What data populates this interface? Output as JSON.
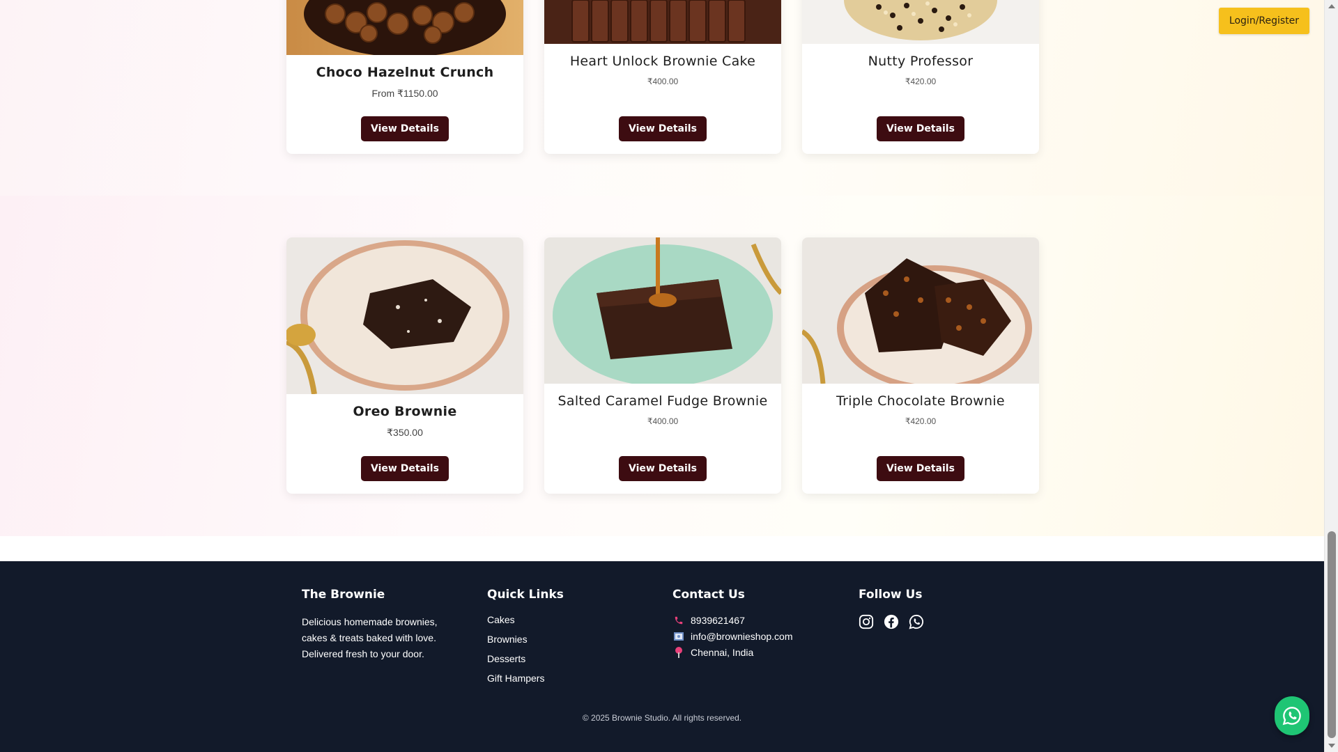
{
  "header": {
    "login_label": "Login/Register"
  },
  "products_top": [
    {
      "name": "Choco Hazelnut Crunch",
      "price": "From ₹1150.00",
      "button": "View Details"
    },
    {
      "name": "Heart Unlock Brownie Cake",
      "price": "₹400.00",
      "button": "View Details"
    },
    {
      "name": "Nutty Professor",
      "price": "₹420.00",
      "button": "View Details"
    }
  ],
  "products_bottom": [
    {
      "name": "Oreo Brownie",
      "price": "₹350.00",
      "button": "View Details"
    },
    {
      "name": "Salted Caramel Fudge Brownie",
      "price": "₹400.00",
      "button": "View Details"
    },
    {
      "name": "Triple Chocolate Brownie",
      "price": "₹420.00",
      "button": "View Details"
    }
  ],
  "footer": {
    "brand": {
      "title": "The Brownie",
      "description": "Delicious homemade brownies, cakes & treats baked with love. Delivered fresh to your door."
    },
    "quick_links": {
      "title": "Quick Links",
      "items": [
        "Cakes",
        "Brownies",
        "Desserts",
        "Gift Hampers"
      ]
    },
    "contact": {
      "title": "Contact Us",
      "phone": "8939621467",
      "email": "info@brownieshop.com",
      "location": "Chennai, India"
    },
    "follow": {
      "title": "Follow Us",
      "icons": [
        "instagram-icon",
        "facebook-icon",
        "whatsapp-icon"
      ]
    },
    "copyright": "© 2025 Brownie Studio. All rights reserved."
  },
  "colors": {
    "button_bg": "#3d0c11",
    "login_bg": "#f6c01c",
    "footer_bg": "#121a2a",
    "whatsapp_green": "#1fc574"
  }
}
